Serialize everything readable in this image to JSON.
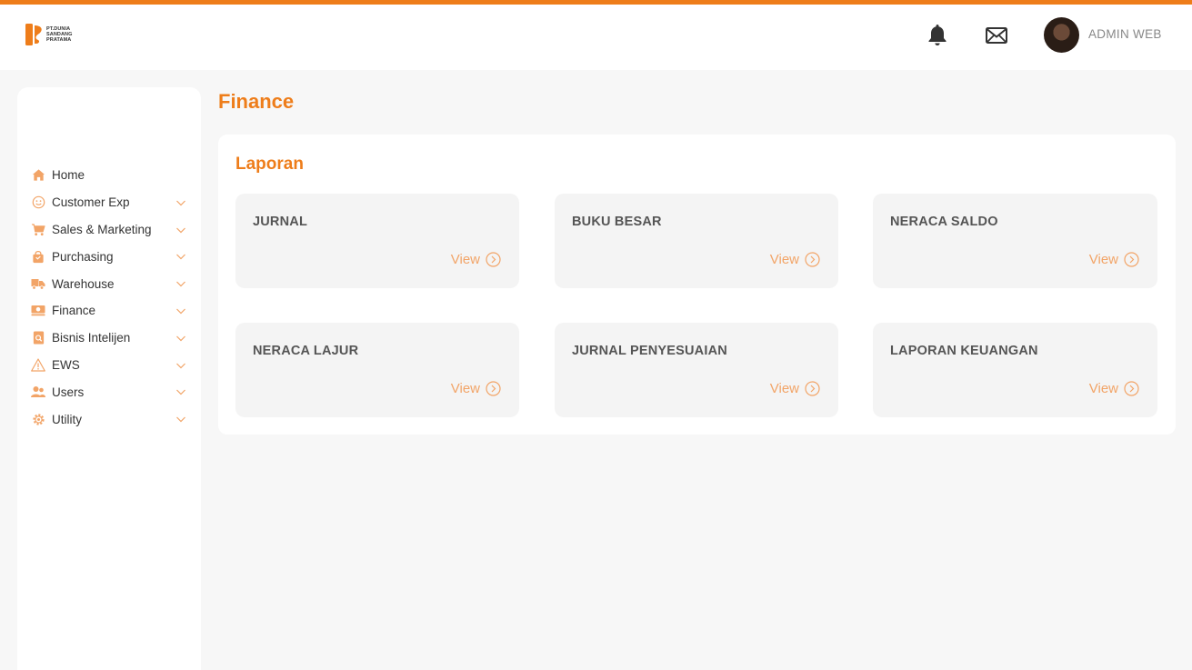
{
  "header": {
    "logo_lines": [
      "PT.DUNIA",
      "SANDANG",
      "PRATAMA"
    ],
    "user_name": "ADMIN WEB",
    "icons": [
      "bell-icon",
      "mail-icon"
    ]
  },
  "sidebar": {
    "items": [
      {
        "label": "Home",
        "icon": "home-icon",
        "expandable": false
      },
      {
        "label": "Customer Exp",
        "icon": "smiley-icon",
        "expandable": true
      },
      {
        "label": "Sales & Marketing",
        "icon": "cart-icon",
        "expandable": true
      },
      {
        "label": "Purchasing",
        "icon": "shopping-bag-icon",
        "expandable": true
      },
      {
        "label": "Warehouse",
        "icon": "truck-icon",
        "expandable": true
      },
      {
        "label": "Finance",
        "icon": "money-icon",
        "expandable": true
      },
      {
        "label": "Bisnis Intelijen",
        "icon": "report-search-icon",
        "expandable": true
      },
      {
        "label": "EWS",
        "icon": "warning-icon",
        "expandable": true
      },
      {
        "label": "Users",
        "icon": "users-icon",
        "expandable": true
      },
      {
        "label": "Utility",
        "icon": "gear-icon",
        "expandable": true
      }
    ]
  },
  "main": {
    "page_title": "Finance",
    "section_title": "Laporan",
    "cards": [
      {
        "title": "JURNAL",
        "action": "View"
      },
      {
        "title": "BUKU BESAR",
        "action": "View"
      },
      {
        "title": "NERACA SALDO",
        "action": "View"
      },
      {
        "title": "NERACA LAJUR",
        "action": "View"
      },
      {
        "title": "JURNAL PENYESUAIAN",
        "action": "View"
      },
      {
        "title": "LAPORAN KEUANGAN",
        "action": "View"
      }
    ]
  },
  "colors": {
    "accent": "#ee7d1a",
    "accent_light": "#f2a467",
    "background": "#f7f7f7",
    "card": "#f4f4f4"
  }
}
